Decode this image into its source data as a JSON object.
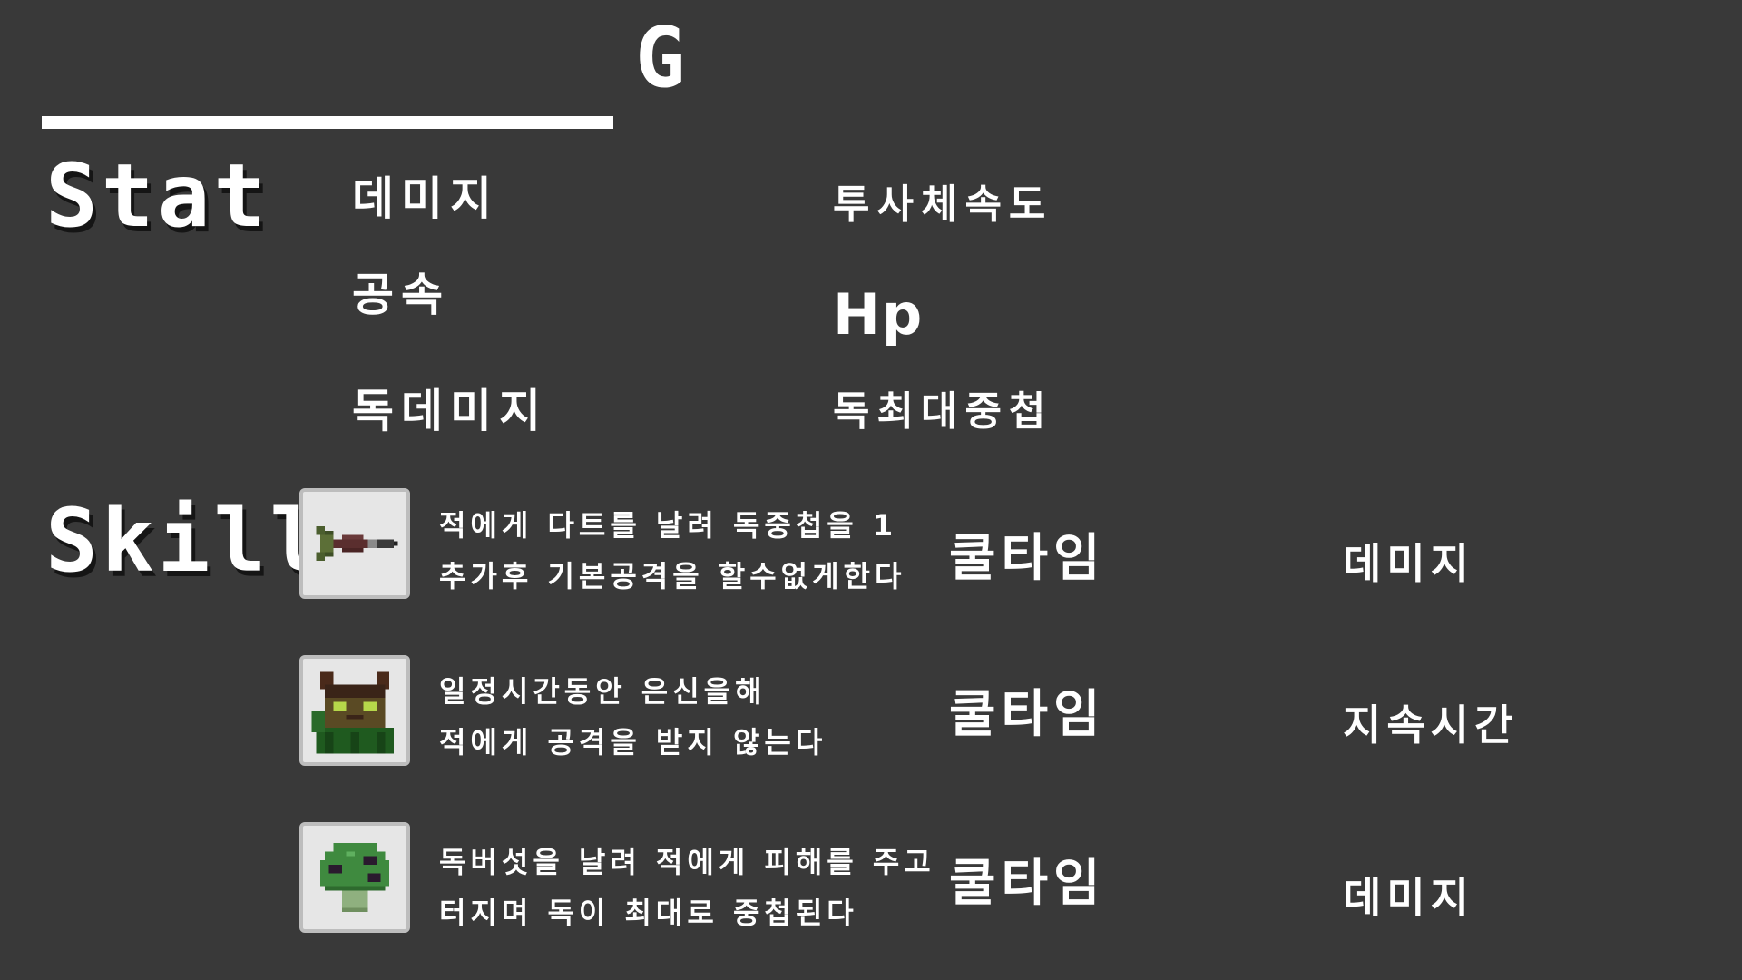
{
  "header": {
    "currency_label": "G"
  },
  "stat": {
    "title": "Stat",
    "left": [
      "데미지",
      "공속",
      "독데미지"
    ],
    "right": [
      "투사체속도",
      "Hp",
      "독최대중첩"
    ]
  },
  "skill": {
    "title": "Skill",
    "items": [
      {
        "icon": "dart-icon",
        "desc_line1": "적에게 다트를 날려 독중첩을 1",
        "desc_line2": "추가후 기본공격을 할수없게한다",
        "cooldown_label": "쿨타임",
        "stat_label": "데미지"
      },
      {
        "icon": "hooded-cat-icon",
        "desc_line1": "일정시간동안 은신을해",
        "desc_line2": "적에게 공격을 받지 않는다",
        "cooldown_label": "쿨타임",
        "stat_label": "지속시간"
      },
      {
        "icon": "poison-mushroom-icon",
        "desc_line1": "독버섯을 날려 적에게 피해를 주고",
        "desc_line2": "터지며 독이 최대로 중첩된다",
        "cooldown_label": "쿨타임",
        "stat_label": "데미지"
      }
    ]
  },
  "colors": {
    "background": "#393939",
    "text": "#ffffff",
    "icon_bg": "#e6e6e6"
  }
}
